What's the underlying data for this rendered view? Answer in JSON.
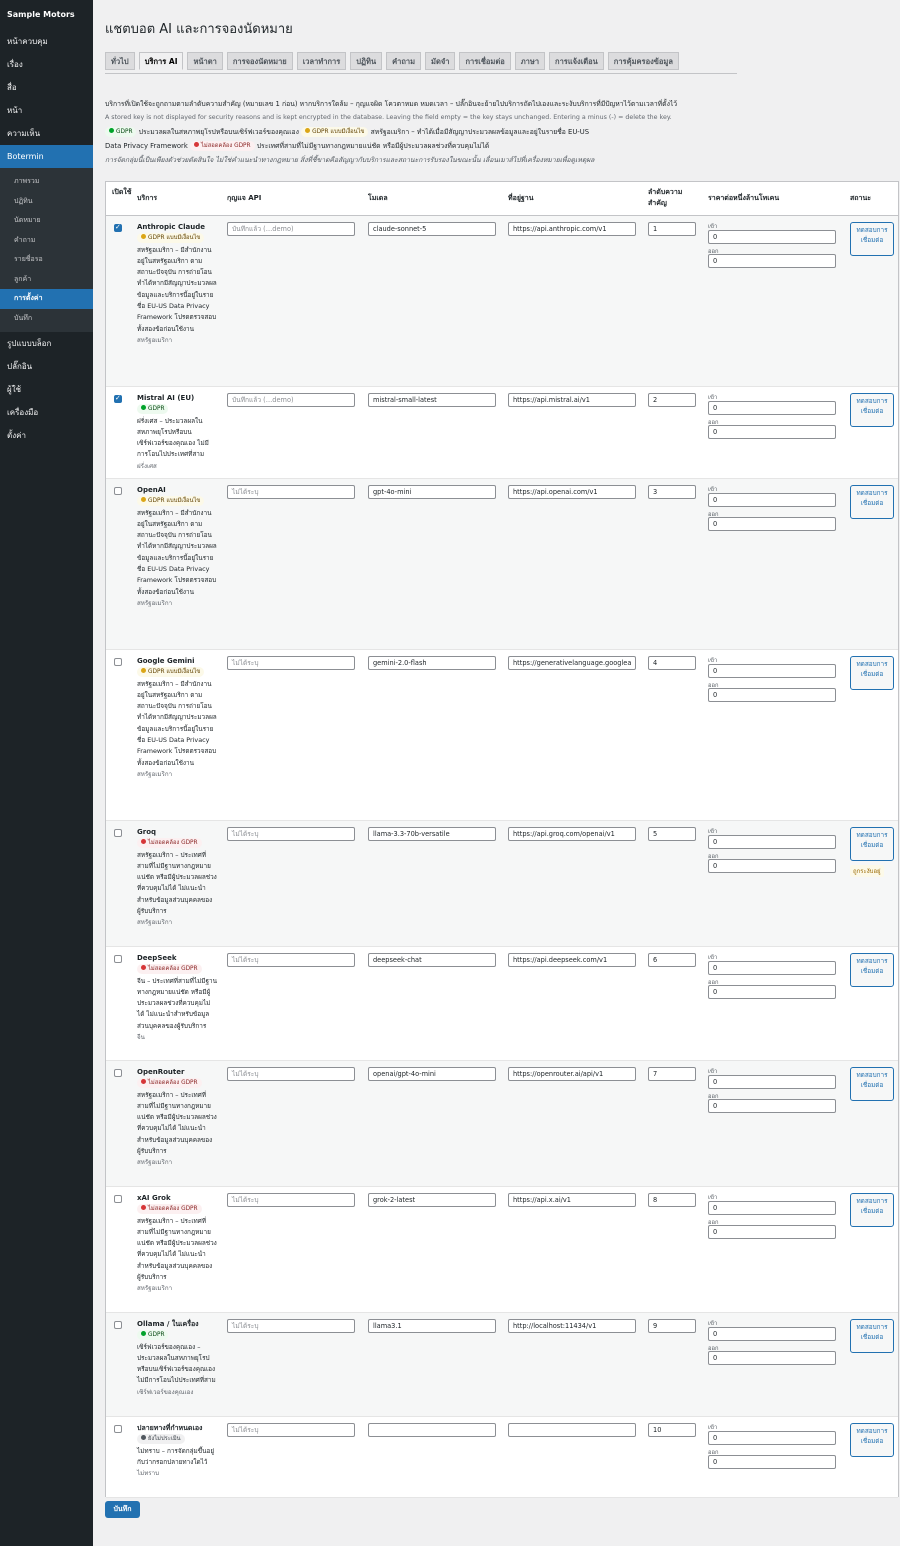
{
  "sidebar": {
    "brand": "Sample Motors",
    "items": [
      "หน้าควบคุม",
      "เรื่อง",
      "สื่อ",
      "หน้า",
      "ความเห็น",
      "Botermin"
    ],
    "submenu": [
      "ภาพรวม",
      "ปฏิทิน",
      "นัดหมาย",
      "คำถาม",
      "รายชื่อรอ",
      "ลูกค้า",
      "การตั้งค่า",
      "บันทึก"
    ],
    "after": [
      "รูปแบบบล็อก",
      "ปลั๊กอิน",
      "ผู้ใช้",
      "เครื่องมือ",
      "ตั้งค่า"
    ]
  },
  "page": {
    "title": "แชตบอต AI และการจองนัดหมาย",
    "tabs": [
      "ทั่วไป",
      "บริการ AI",
      "หน้าตา",
      "การจองนัดหมาย",
      "เวลาทำการ",
      "ปฏิทิน",
      "คำถาม",
      "มัดจำ",
      "การเชื่อมต่อ",
      "ภาษา",
      "การแจ้งเตือน",
      "การคุ้มครองข้อมูล"
    ],
    "active_tab": "บริการ AI",
    "intro_1": "บริการที่เปิดใช้จะถูกถามตามลำดับความสำคัญ (หมายเลข 1 ก่อน) หากบริการใดล้ม – กุญแจผิด โควตาหมด หมดเวลา – ปลั๊กอินจะย้ายไปบริการถัดไปเองและระงับบริการที่มีปัญหาไว้ตามเวลาที่ตั้งไว้",
    "intro_2": "A stored key is not displayed for security reasons and is kept encrypted in the database. Leaving the field empty = the key stays unchanged. Entering a minus (-) = delete the key.",
    "legend_gdpr": "GDPR",
    "legend_gdpr_text": "ประมวลผลในสหภาพยุโรปหรือบนเซิร์ฟเวอร์ของคุณเอง",
    "legend_cond": "GDPR แบบมีเงื่อนไข",
    "legend_cond_text": "สหรัฐอเมริกา – ทำได้เมื่อมีสัญญาประมวลผลข้อมูลและอยู่ในรายชื่อ EU-US",
    "legend_cond_text2": "Data Privacy Framework",
    "legend_bad": "ไม่สอดคล้อง GDPR",
    "legend_bad_text": "ประเทศที่สามที่ไม่มีฐานทางกฎหมายแน่ชัด หรือมีผู้ประมวลผลช่วงที่ควบคุมไม่ได้",
    "disclaimer": "การจัดกลุ่มนี้เป็นเพียงตัวช่วยตัดสินใจ ไม่ใช่คำแนะนำทางกฎหมาย สิ่งที่ชี้ขาดคือสัญญากับบริการและสถานะการรับรองในขณะนั้น เลื่อนเมาส์ไปที่เครื่องหมายเพื่อดูเหตุผล"
  },
  "table": {
    "headers": {
      "enabled": "เปิดใช้",
      "service": "บริการ",
      "api_key": "กุญแจ API",
      "model": "โมเดล",
      "url": "ที่อยู่ฐาน",
      "priority": "ลำดับความสำคัญ",
      "price": "ราคาต่อหนึ่งล้านโทเคน",
      "status": "สถานะ"
    },
    "price_in": "เข้า",
    "price_out": "ออก",
    "test_button": "ทดสอบการเชื่อมต่อ",
    "rows": [
      {
        "enabled": true,
        "name": "Anthropic Claude",
        "badge": "GDPR แบบมีเงื่อนไข",
        "badge_type": "warn",
        "desc": "สหรัฐอเมริกา – มีสำนักงานอยู่ในสหรัฐอเมริกา ตามสถานะปัจจุบัน การถ่ายโอนทำได้หากมีสัญญาประมวลผลข้อมูลและบริการนี้อยู่ในรายชื่อ EU-US Data Privacy Framework โปรดตรวจสอบทั้งสองข้อก่อนใช้งาน",
        "note": "สหรัฐอเมริกา",
        "key": "บันทึกแล้ว (…demo)",
        "model": "claude-sonnet-5",
        "url": "https://api.anthropic.com/v1",
        "priority": "1",
        "in": "0",
        "out": "0",
        "status": ""
      },
      {
        "enabled": true,
        "name": "Mistral AI (EU)",
        "badge": "GDPR",
        "badge_type": "ok",
        "desc": "ฝรั่งเศส – ประมวลผลในสหภาพยุโรปหรือบนเซิร์ฟเวอร์ของคุณเอง ไม่มีการโอนไปประเทศที่สาม",
        "note": "ฝรั่งเศส",
        "key": "บันทึกแล้ว (…demo)",
        "model": "mistral-small-latest",
        "url": "https://api.mistral.ai/v1",
        "priority": "2",
        "in": "0",
        "out": "0",
        "status": ""
      },
      {
        "enabled": false,
        "name": "OpenAI",
        "badge": "GDPR แบบมีเงื่อนไข",
        "badge_type": "warn",
        "desc": "สหรัฐอเมริกา – มีสำนักงานอยู่ในสหรัฐอเมริกา ตามสถานะปัจจุบัน การถ่ายโอนทำได้หากมีสัญญาประมวลผลข้อมูลและบริการนี้อยู่ในรายชื่อ EU-US Data Privacy Framework โปรดตรวจสอบทั้งสองข้อก่อนใช้งาน",
        "note": "สหรัฐอเมริกา",
        "key": "ไม่ได้ระบุ",
        "model": "gpt-4o-mini",
        "url": "https://api.openai.com/v1",
        "priority": "3",
        "in": "0",
        "out": "0",
        "status": ""
      },
      {
        "enabled": false,
        "name": "Google Gemini",
        "badge": "GDPR แบบมีเงื่อนไข",
        "badge_type": "warn",
        "desc": "สหรัฐอเมริกา – มีสำนักงานอยู่ในสหรัฐอเมริกา ตามสถานะปัจจุบัน การถ่ายโอนทำได้หากมีสัญญาประมวลผลข้อมูลและบริการนี้อยู่ในรายชื่อ EU-US Data Privacy Framework โปรดตรวจสอบทั้งสองข้อก่อนใช้งาน",
        "note": "สหรัฐอเมริกา",
        "key": "ไม่ได้ระบุ",
        "model": "gemini-2.0-flash",
        "url": "https://generativelanguage.googlea",
        "priority": "4",
        "in": "0",
        "out": "0",
        "status": ""
      },
      {
        "enabled": false,
        "name": "Groq",
        "badge": "ไม่สอดคล้อง GDPR",
        "badge_type": "bad",
        "desc": "สหรัฐอเมริกา – ประเทศที่สามที่ไม่มีฐานทางกฎหมายแน่ชัด หรือมีผู้ประมวลผลช่วงที่ควบคุมไม่ได้ ไม่แนะนำสำหรับข้อมูลส่วนบุคคลของผู้รับบริการ",
        "note": "สหรัฐอเมริกา",
        "key": "ไม่ได้ระบุ",
        "model": "llama-3.3-70b-versatile",
        "url": "https://api.groq.com/openai/v1",
        "priority": "5",
        "in": "0",
        "out": "0",
        "status": "ถูกระงับอยู่"
      },
      {
        "enabled": false,
        "name": "DeepSeek",
        "badge": "ไม่สอดคล้อง GDPR",
        "badge_type": "bad",
        "desc": "จีน – ประเทศที่สามที่ไม่มีฐานทางกฎหมายแน่ชัด หรือมีผู้ประมวลผลช่วงที่ควบคุมไม่ได้ ไม่แนะนำสำหรับข้อมูลส่วนบุคคลของผู้รับบริการ",
        "note": "จีน",
        "key": "ไม่ได้ระบุ",
        "model": "deepseek-chat",
        "url": "https://api.deepseek.com/v1",
        "priority": "6",
        "in": "0",
        "out": "0",
        "status": ""
      },
      {
        "enabled": false,
        "name": "OpenRouter",
        "badge": "ไม่สอดคล้อง GDPR",
        "badge_type": "bad",
        "desc": "สหรัฐอเมริกา – ประเทศที่สามที่ไม่มีฐานทางกฎหมายแน่ชัด หรือมีผู้ประมวลผลช่วงที่ควบคุมไม่ได้ ไม่แนะนำสำหรับข้อมูลส่วนบุคคลของผู้รับบริการ",
        "note": "สหรัฐอเมริกา",
        "key": "ไม่ได้ระบุ",
        "model": "openai/gpt-4o-mini",
        "url": "https://openrouter.ai/api/v1",
        "priority": "7",
        "in": "0",
        "out": "0",
        "status": ""
      },
      {
        "enabled": false,
        "name": "xAI Grok",
        "badge": "ไม่สอดคล้อง GDPR",
        "badge_type": "bad",
        "desc": "สหรัฐอเมริกา – ประเทศที่สามที่ไม่มีฐานทางกฎหมายแน่ชัด หรือมีผู้ประมวลผลช่วงที่ควบคุมไม่ได้ ไม่แนะนำสำหรับข้อมูลส่วนบุคคลของผู้รับบริการ",
        "note": "สหรัฐอเมริกา",
        "key": "ไม่ได้ระบุ",
        "model": "grok-2-latest",
        "url": "https://api.x.ai/v1",
        "priority": "8",
        "in": "0",
        "out": "0",
        "status": ""
      },
      {
        "enabled": false,
        "name": "Ollama / ในเครื่อง",
        "badge": "GDPR",
        "badge_type": "ok",
        "desc": "เซิร์ฟเวอร์ของคุณเอง – ประมวลผลในสหภาพยุโรปหรือบนเซิร์ฟเวอร์ของคุณเอง ไม่มีการโอนไปประเทศที่สาม",
        "note": "เซิร์ฟเวอร์ของคุณเอง",
        "key": "ไม่ได้ระบุ",
        "model": "llama3.1",
        "url": "http://localhost:11434/v1",
        "priority": "9",
        "in": "0",
        "out": "0",
        "status": ""
      },
      {
        "enabled": false,
        "name": "ปลายทางที่กำหนดเอง",
        "badge": "ยังไม่ประเมิน",
        "badge_type": "unk",
        "desc": "ไม่ทราบ – การจัดกลุ่มขึ้นอยู่กับว่ากรอกปลายทางใดไว้",
        "note": "ไม่ทราบ",
        "key": "ไม่ได้ระบุ",
        "model": "",
        "url": "",
        "priority": "10",
        "in": "0",
        "out": "0",
        "status": ""
      }
    ]
  },
  "save_label": "บันทึก"
}
